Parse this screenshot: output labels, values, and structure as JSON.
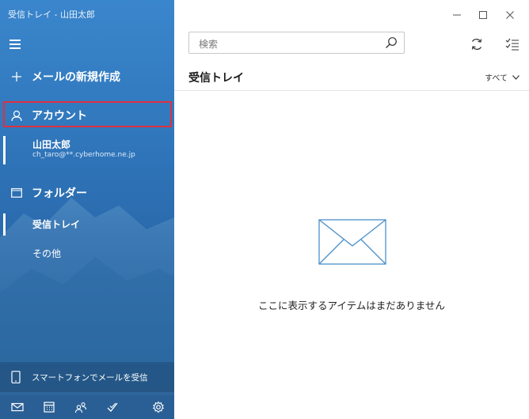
{
  "window": {
    "title": "受信トレイ - 山田太郎"
  },
  "sidebar": {
    "new_mail_label": "メールの新規作成",
    "account_label": "アカウント",
    "account": {
      "name": "山田太郎",
      "email": "ch_taro@**.cyberhome.ne.jp"
    },
    "folder_label": "フォルダー",
    "folders": [
      {
        "label": "受信トレイ",
        "selected": true
      },
      {
        "label": "その他",
        "selected": false
      }
    ],
    "phone_label": "スマートフォンでメールを受信",
    "bottom_icons": [
      "mail-icon",
      "calendar-icon",
      "people-icon",
      "todo-icon",
      "settings-icon"
    ]
  },
  "main": {
    "search_placeholder": "検索",
    "folder_title": "受信トレイ",
    "filter_label": "すべて",
    "empty_message": "ここに表示するアイテムはまだありません"
  },
  "colors": {
    "sidebar": "#3178bd",
    "highlight_border": "#e03040",
    "envelope": "#4a90c8"
  }
}
